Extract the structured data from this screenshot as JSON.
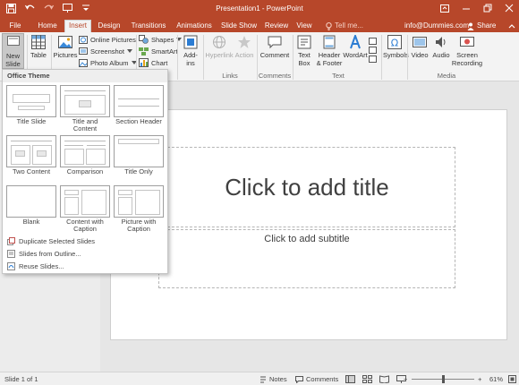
{
  "window": {
    "title": "Presentation1 - PowerPoint"
  },
  "tabs": [
    "File",
    "Home",
    "Insert",
    "Design",
    "Transitions",
    "Animations",
    "Slide Show",
    "Review",
    "View"
  ],
  "active_tab": "Insert",
  "tell_me": "Tell me...",
  "account": "info@Dummies.com",
  "share_label": "Share",
  "ribbon": {
    "new_slide": "New Slide",
    "table": "Table",
    "pictures": "Pictures",
    "online_pictures": "Online Pictures",
    "screenshot": "Screenshot",
    "photo_album": "Photo Album",
    "shapes": "Shapes",
    "smartart": "SmartArt",
    "chart": "Chart",
    "addins": "Add-ins",
    "hyperlink": "Hyperlink",
    "action": "Action",
    "comment": "Comment",
    "text_box": "Text Box",
    "header_footer": "Header & Footer",
    "wordart": "WordArt",
    "symbols": "Symbols",
    "video": "Video",
    "audio": "Audio",
    "screen_recording": "Screen Recording",
    "groups": {
      "links": "Links",
      "comments": "Comments",
      "text": "Text",
      "media": "Media"
    }
  },
  "dropdown": {
    "header": "Office Theme",
    "layouts": [
      "Title Slide",
      "Title and Content",
      "Section Header",
      "Two Content",
      "Comparison",
      "Title Only",
      "Blank",
      "Content with Caption",
      "Picture with Caption"
    ],
    "menu": [
      "Duplicate Selected Slides",
      "Slides from Outline...",
      "Reuse Slides..."
    ]
  },
  "slide": {
    "title_placeholder": "Click to add title",
    "subtitle_placeholder": "Click to add subtitle"
  },
  "status": {
    "slide_counter": "Slide 1 of 1",
    "notes": "Notes",
    "comments": "Comments",
    "zoom": "61%"
  },
  "colors": {
    "accent": "#b7472a",
    "ribbon_bg": "#f3f3f3"
  }
}
